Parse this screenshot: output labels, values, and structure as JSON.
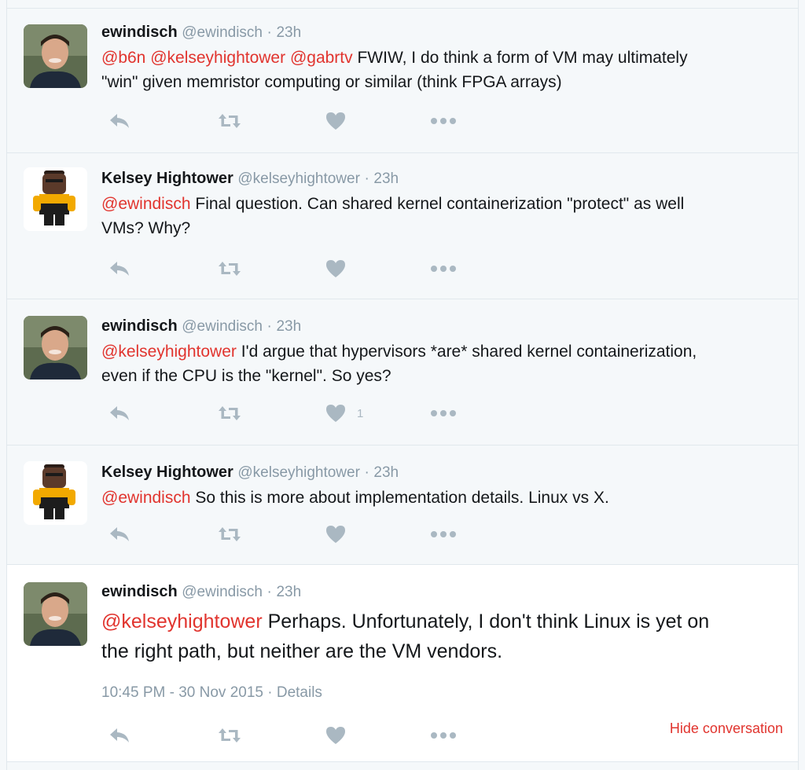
{
  "tweets": [
    {
      "name": "ewindisch",
      "handle": "@ewindisch",
      "dot": "·",
      "time": "23h",
      "mentions": [
        "@b6n",
        "@kelseyhightower",
        "@gabrtv"
      ],
      "text_line1_rest": "FWIW, I do think a form of VM may ultimately",
      "text_line2": "\"win\" given memristor computing or similar (think FPGA arrays)",
      "like_count": ""
    },
    {
      "name": "Kelsey Hightower",
      "handle": "@kelseyhightower",
      "dot": "·",
      "time": "23h",
      "mention": "@ewindisch",
      "text_line1_rest": "Final question. Can shared kernel containerization \"protect\" as well",
      "text_line2": "VMs? Why?",
      "like_count": ""
    },
    {
      "name": "ewindisch",
      "handle": "@ewindisch",
      "dot": "·",
      "time": "23h",
      "mention": "@kelseyhightower",
      "text_line1_rest": "I'd argue that hypervisors *are* shared kernel containerization,",
      "text_line2": "even if the CPU is the \"kernel\". So yes?",
      "like_count": "1"
    },
    {
      "name": "Kelsey Hightower",
      "handle": "@kelseyhightower",
      "dot": "·",
      "time": "23h",
      "mention": "@ewindisch",
      "text_line1_rest": "So this is more about implementation details. Linux vs X.",
      "like_count": ""
    },
    {
      "name": "ewindisch",
      "handle": "@ewindisch",
      "dot": "·",
      "time": "23h",
      "mention": "@kelseyhightower",
      "text_line1_rest": "Perhaps. Unfortunately, I don't think Linux is yet on",
      "text_line2": "the right path, but neither are the VM vendors.",
      "timestamp": "10:45 PM - 30 Nov 2015",
      "meta_dot": "·",
      "details": "Details",
      "hide_conversation": "Hide conversation"
    }
  ],
  "icons": {
    "reply": "reply-icon",
    "retweet": "retweet-icon",
    "like": "heart-icon",
    "more": "more-dots-icon"
  },
  "colors": {
    "mention": "#e1342e",
    "meta_gray": "#8899a6",
    "icon_gray": "#aab8c2",
    "background": "#f5f8fa"
  }
}
